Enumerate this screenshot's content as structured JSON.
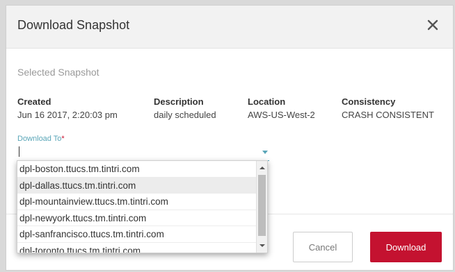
{
  "dialog": {
    "title": "Download Snapshot",
    "close_icon": "close-icon"
  },
  "snapshot": {
    "section_title": "Selected Snapshot",
    "columns": [
      {
        "label": "Created",
        "value": "Jun 16 2017, 2:20:03 pm"
      },
      {
        "label": "Description",
        "value": "daily scheduled"
      },
      {
        "label": "Location",
        "value": "AWS-US-West-2"
      },
      {
        "label": "Consistency",
        "value": "CRASH CONSISTENT"
      }
    ]
  },
  "download_to": {
    "label": "Download To",
    "required_mark": "*",
    "value": "",
    "options": [
      "dpl-boston.ttucs.tm.tintri.com",
      "dpl-dallas.ttucs.tm.tintri.com",
      "dpl-mountainview.ttucs.tm.tintri.com",
      "dpl-newyork.ttucs.tm.tintri.com",
      "dpl-sanfrancisco.ttucs.tm.tintri.com",
      "dpl-toronto.ttucs.tm.tintri.com"
    ],
    "hovered_index": 1
  },
  "footer": {
    "cancel_label": "Cancel",
    "download_label": "Download"
  },
  "colors": {
    "accent": "#5aa6b8",
    "primary_button": "#c41230"
  }
}
